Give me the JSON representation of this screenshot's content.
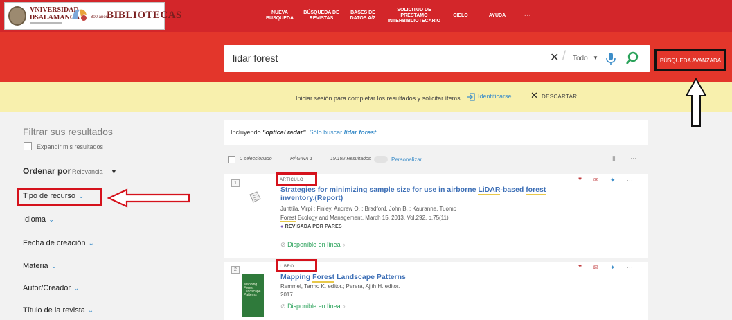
{
  "header": {
    "university_name_line1": "VNIVERSIDAD",
    "university_name_line2": "DSALAMANCA",
    "seal_caption": "800 años",
    "library_name": "BIBLIOTECAS",
    "nav": [
      {
        "label": "NUEVA BÚSQUEDA"
      },
      {
        "label": "BÚSQUEDA DE REVISTAS"
      },
      {
        "label": "BASES DE DATOS A/Z"
      },
      {
        "label": "SOLICITUD DE PRÉSTAMO INTERBIBLIOTECARIO"
      },
      {
        "label": "CIELO"
      },
      {
        "label": "AYUDA"
      },
      {
        "label": "···"
      }
    ]
  },
  "search": {
    "query": "lidar forest",
    "scope": "Todo",
    "advanced_label": "BÚSQUEDA AVANZADA"
  },
  "login_banner": {
    "message": "Iniciar sesión para completar los resultados y solicitar ítems",
    "identify_label": "Identificarse",
    "dismiss_label": "DESCARTAR"
  },
  "sidebar": {
    "title": "Filtrar sus resultados",
    "expand_label": "Expandir mis resultados",
    "sort_label": "Ordenar por",
    "sort_value": "Relevancia",
    "facets": [
      {
        "label": "Tipo de recurso"
      },
      {
        "label": "Idioma"
      },
      {
        "label": "Fecha de creación"
      },
      {
        "label": "Materia"
      },
      {
        "label": "Autor/Creador"
      },
      {
        "label": "Título de la revista"
      }
    ]
  },
  "results": {
    "including_prefix": "Incluyendo ",
    "including_term": "\"optical radar\"",
    "including_mid": ". ",
    "only_search_prefix": "Sólo buscar ",
    "only_search_term": "lidar forest",
    "selected": "0 seleccionado",
    "page_label": "PÁGINA 1",
    "count": "19.192 Resultados",
    "personalize": "Personalizar",
    "items": [
      {
        "index": "1",
        "type": "ARTÍCULO",
        "title_a": "Strategies for minimizing sample size for use in airborne ",
        "title_hl1": "LiDAR",
        "title_b": "-based ",
        "title_hl2": "forest",
        "title_c": "inventory.(Report)",
        "authors": "Junttila, Virpi ; Finley, Andrew O. ; Bradford, John B. ; Kauranne, Tuomo",
        "source_hl": "Forest",
        "source": " Ecology and Management, March 15, 2013, Vol.292, p.75(11)",
        "peer_review": "REVISADA POR PARES",
        "availability": "Disponible en línea"
      },
      {
        "index": "2",
        "type": "LIBRO",
        "title_a": "Mapping ",
        "title_hl1": "Forest",
        "title_b": " Landscape Patterns",
        "authors": "Remmel, Tarmo K. editor.; Perera, Ajith H. editor.",
        "year": "2017",
        "availability": "Disponible en línea",
        "cover_text": "Mapping Forest Landscape Patterns"
      }
    ]
  },
  "colors": {
    "header_red": "#d3262a",
    "search_band_red": "#e3362b",
    "banner_yellow": "#f8f0ad",
    "link_blue": "#3d8ec9",
    "available_green": "#2aa25a",
    "annotation_red": "#d5121c"
  }
}
